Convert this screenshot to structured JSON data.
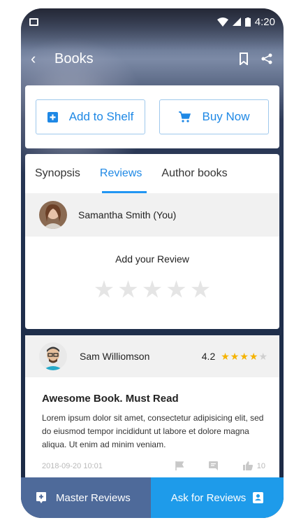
{
  "status_bar": {
    "time": "4:20"
  },
  "app_bar": {
    "title": "Books"
  },
  "actions": {
    "add_to_shelf": "Add to Shelf",
    "buy_now": "Buy Now"
  },
  "tabs": [
    {
      "label": "Synopsis"
    },
    {
      "label": "Reviews"
    },
    {
      "label": "Author books"
    }
  ],
  "active_tab": "Reviews",
  "my_review": {
    "name": "Samantha Smith (You)",
    "prompt": "Add your Review",
    "rating": 0,
    "max_rating": 5
  },
  "review": {
    "author": "Sam Williomson",
    "rating": "4.2",
    "stars_filled": 4,
    "max_stars": 5,
    "title": "Awesome Book. Must Read",
    "body": "Lorem ipsum dolor sit amet, consectetur adipisicing elit, sed do eiusmod tempor incididunt ut labore et dolore magna aliqua. Ut enim ad minim veniam.",
    "date": "2018-09-20 10:01",
    "likes": "10"
  },
  "bottom_bar": {
    "master_reviews": "Master Reviews",
    "ask_reviews": "Ask for Reviews"
  },
  "colors": {
    "accent": "#1e88e5",
    "star": "#f5b301",
    "left_button": "#4e6a9a",
    "right_button": "#1e9bea"
  }
}
